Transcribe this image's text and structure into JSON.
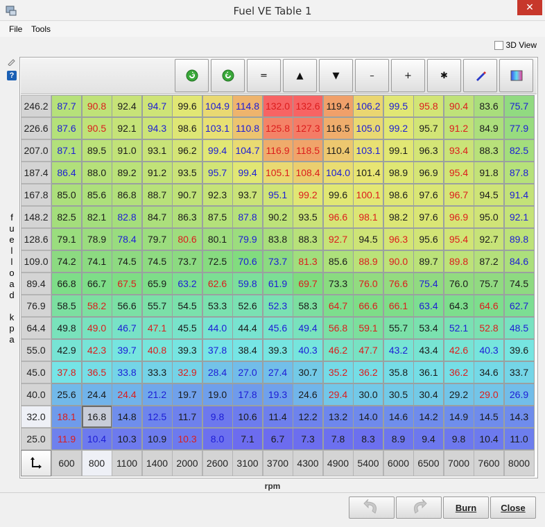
{
  "window": {
    "title": "Fuel VE Table 1",
    "close_glyph": "✕"
  },
  "menu": {
    "file": "File",
    "tools": "Tools"
  },
  "view3d": {
    "label": "3D View",
    "checked": false
  },
  "yaxis": {
    "title": "fuel load kpa",
    "title_chars": [
      "f",
      "u",
      "e",
      "l",
      "l",
      "o",
      "a",
      "d",
      "",
      "k",
      "p",
      "a"
    ]
  },
  "xaxis": {
    "title": "rpm"
  },
  "toolbar": {
    "buttons": [
      {
        "name": "undo-green-icon",
        "label": ""
      },
      {
        "name": "redo-green-icon",
        "label": ""
      },
      {
        "name": "set-equal-icon",
        "label": "="
      },
      {
        "name": "increment-up-icon",
        "label": "▲"
      },
      {
        "name": "decrement-down-icon",
        "label": "▼"
      },
      {
        "name": "subtract-icon",
        "label": "–"
      },
      {
        "name": "add-icon",
        "label": "+"
      },
      {
        "name": "multiply-icon",
        "label": "✱"
      },
      {
        "name": "interpolate-pencil-icon",
        "label": ""
      },
      {
        "name": "color-scale-icon",
        "label": ""
      }
    ]
  },
  "table": {
    "rpm": [
      "600",
      "800",
      "1100",
      "1400",
      "2000",
      "2600",
      "3100",
      "3700",
      "4300",
      "4900",
      "5400",
      "6000",
      "6500",
      "7000",
      "7600",
      "8000"
    ],
    "rows": [
      {
        "load": "246.2",
        "values": [
          "87.7",
          "90.8",
          "92.4",
          "94.7",
          "99.6",
          "104.9",
          "114.8",
          "132.0",
          "132.6",
          "119.4",
          "106.2",
          "99.5",
          "95.8",
          "90.4",
          "83.6",
          "75.7"
        ]
      },
      {
        "load": "226.6",
        "values": [
          "87.6",
          "90.5",
          "92.1",
          "94.3",
          "98.6",
          "103.1",
          "110.8",
          "125.8",
          "127.3",
          "116.5",
          "105.0",
          "99.2",
          "95.7",
          "91.2",
          "84.9",
          "77.9"
        ]
      },
      {
        "load": "207.0",
        "values": [
          "87.1",
          "89.5",
          "91.0",
          "93.1",
          "96.2",
          "99.4",
          "104.7",
          "116.9",
          "118.5",
          "110.4",
          "103.1",
          "99.1",
          "96.3",
          "93.4",
          "88.3",
          "82.5"
        ]
      },
      {
        "load": "187.4",
        "values": [
          "86.4",
          "88.0",
          "89.2",
          "91.2",
          "93.5",
          "95.7",
          "99.4",
          "105.1",
          "108.4",
          "104.0",
          "101.4",
          "98.9",
          "96.9",
          "95.4",
          "91.8",
          "87.8"
        ]
      },
      {
        "load": "167.8",
        "values": [
          "85.0",
          "85.6",
          "86.8",
          "88.7",
          "90.7",
          "92.3",
          "93.7",
          "95.1",
          "99.2",
          "99.6",
          "100.1",
          "98.6",
          "97.6",
          "96.7",
          "94.5",
          "91.4"
        ]
      },
      {
        "load": "148.2",
        "values": [
          "82.5",
          "82.1",
          "82.8",
          "84.7",
          "86.3",
          "87.5",
          "87.8",
          "90.2",
          "93.5",
          "96.6",
          "98.1",
          "98.2",
          "97.6",
          "96.9",
          "95.0",
          "92.1"
        ]
      },
      {
        "load": "128.6",
        "values": [
          "79.1",
          "78.9",
          "78.4",
          "79.7",
          "80.6",
          "80.1",
          "79.9",
          "83.8",
          "88.3",
          "92.7",
          "94.5",
          "96.3",
          "95.6",
          "95.4",
          "92.7",
          "89.8"
        ]
      },
      {
        "load": "109.0",
        "values": [
          "74.2",
          "74.1",
          "74.5",
          "74.5",
          "73.7",
          "72.5",
          "70.6",
          "73.7",
          "81.3",
          "85.6",
          "88.9",
          "90.0",
          "89.7",
          "89.8",
          "87.2",
          "84.6"
        ]
      },
      {
        "load": "89.4",
        "values": [
          "66.8",
          "66.7",
          "67.5",
          "65.9",
          "63.2",
          "62.6",
          "59.8",
          "61.9",
          "69.7",
          "73.3",
          "76.0",
          "76.6",
          "75.4",
          "76.0",
          "75.7",
          "74.5"
        ]
      },
      {
        "load": "76.9",
        "values": [
          "58.5",
          "58.2",
          "56.6",
          "55.7",
          "54.5",
          "53.3",
          "52.6",
          "52.3",
          "58.3",
          "64.7",
          "66.6",
          "66.1",
          "63.4",
          "64.3",
          "64.6",
          "62.7"
        ]
      },
      {
        "load": "64.4",
        "values": [
          "49.8",
          "49.0",
          "46.7",
          "47.1",
          "45.5",
          "44.0",
          "44.4",
          "45.6",
          "49.4",
          "56.8",
          "59.1",
          "55.7",
          "53.4",
          "52.1",
          "52.8",
          "48.5"
        ]
      },
      {
        "load": "55.0",
        "values": [
          "42.9",
          "42.3",
          "39.7",
          "40.8",
          "39.3",
          "37.8",
          "38.4",
          "39.3",
          "40.3",
          "46.2",
          "47.7",
          "43.2",
          "43.4",
          "42.6",
          "40.3",
          "39.6"
        ]
      },
      {
        "load": "45.0",
        "values": [
          "37.8",
          "36.5",
          "33.8",
          "33.3",
          "32.9",
          "28.4",
          "27.0",
          "27.4",
          "30.7",
          "35.2",
          "36.2",
          "35.8",
          "36.1",
          "36.2",
          "34.6",
          "33.7"
        ]
      },
      {
        "load": "40.0",
        "values": [
          "25.6",
          "24.4",
          "24.4",
          "21.2",
          "19.7",
          "19.0",
          "17.8",
          "19.3",
          "24.6",
          "29.4",
          "30.0",
          "30.5",
          "30.4",
          "29.2",
          "29.0",
          "26.9"
        ]
      },
      {
        "load": "32.0",
        "values": [
          "18.1",
          "16.8",
          "14.8",
          "12.5",
          "11.7",
          "9.8",
          "10.6",
          "11.4",
          "12.2",
          "13.2",
          "14.0",
          "14.6",
          "14.2",
          "14.9",
          "14.5",
          "14.3"
        ]
      },
      {
        "load": "25.0",
        "values": [
          "11.9",
          "10.4",
          "10.3",
          "10.9",
          "10.3",
          "8.0",
          "7.1",
          "6.7",
          "7.3",
          "7.8",
          "8.3",
          "8.9",
          "9.4",
          "9.8",
          "10.4",
          "11.0"
        ]
      }
    ],
    "selected": {
      "row": 14,
      "col": 1
    },
    "colors": {
      "text_high": "#dc1c1c",
      "text_mid": "#1a1a1a",
      "text_low": "#1c1cd6"
    }
  },
  "bottom": {
    "undo": "",
    "redo": "",
    "burn": "Burn",
    "close": "Close"
  }
}
